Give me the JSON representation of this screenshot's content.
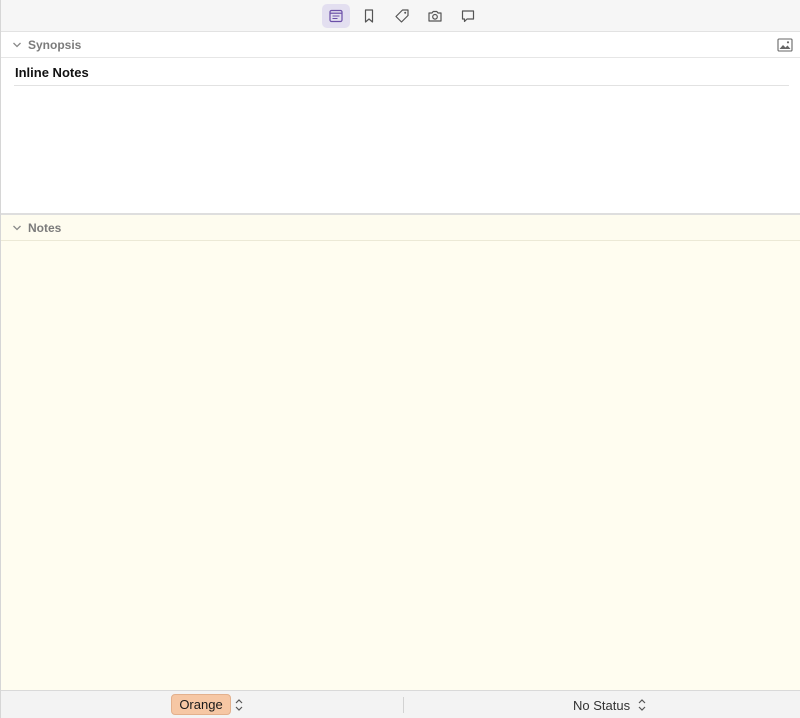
{
  "toolbar": {
    "buttons": [
      {
        "icon": "notes-icon",
        "active": true
      },
      {
        "icon": "bookmark-icon",
        "active": false
      },
      {
        "icon": "tag-icon",
        "active": false
      },
      {
        "icon": "camera-icon",
        "active": false
      },
      {
        "icon": "comment-icon",
        "active": false
      }
    ]
  },
  "synopsis": {
    "header": "Synopsis",
    "title": "Inline Notes"
  },
  "notes": {
    "header": "Notes"
  },
  "footer": {
    "label": "Orange",
    "status": "No Status"
  },
  "colors": {
    "accent": "#6b4fa8",
    "label_orange": "#f6c7a4",
    "notes_bg": "#fffdf0"
  }
}
